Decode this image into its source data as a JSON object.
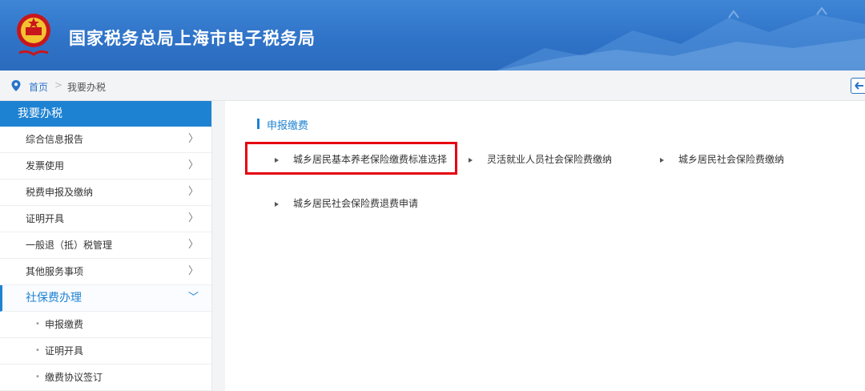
{
  "header": {
    "title": "国家税务总局上海市电子税务局"
  },
  "breadcrumb": {
    "home": "首页",
    "separator": ">",
    "current": "我要办税"
  },
  "sidebar": {
    "heading": "我要办税",
    "items": [
      {
        "label": "综合信息报告",
        "chevron": "〉"
      },
      {
        "label": "发票使用",
        "chevron": "〉"
      },
      {
        "label": "税费申报及缴纳",
        "chevron": "〉"
      },
      {
        "label": "证明开具",
        "chevron": "〉"
      },
      {
        "label": "一般退（抵）税管理",
        "chevron": "〉"
      },
      {
        "label": "其他服务事项",
        "chevron": "〉"
      },
      {
        "label": "社保费办理",
        "chevron": "﹀"
      }
    ],
    "subitems": [
      {
        "label": "申报缴费"
      },
      {
        "label": "证明开具"
      },
      {
        "label": "缴费协议签订"
      }
    ]
  },
  "main": {
    "section_title": "申报缴费",
    "links": [
      {
        "label": "城乡居民基本养老保险缴费标准选择"
      },
      {
        "label": "灵活就业人员社会保险费缴纳"
      },
      {
        "label": "城乡居民社会保险费缴纳"
      },
      {
        "label": "城乡居民社会保险费退费申请"
      }
    ]
  },
  "colors": {
    "header_blue": "#2f73c8",
    "accent": "#1e82d2",
    "highlight_red": "#e60012"
  },
  "icons": {
    "location": "map-pin-icon",
    "back": "back-arrow-icon",
    "emblem": "tax-emblem-icon",
    "link": "triangle-right-icon"
  }
}
